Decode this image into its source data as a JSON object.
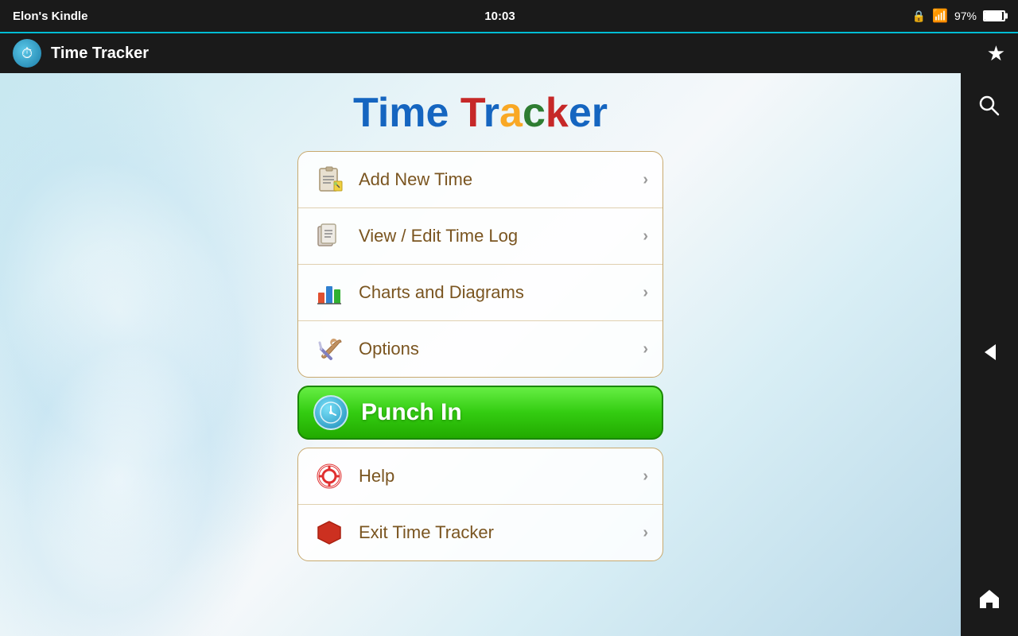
{
  "statusBar": {
    "deviceName": "Elon's Kindle",
    "time": "10:03",
    "batteryPercent": "97%"
  },
  "titleBar": {
    "appTitle": "Time Tracker"
  },
  "heading": {
    "text": "Time Tracker",
    "part1": "Time ",
    "part2": "Tracker"
  },
  "menu": {
    "card1": [
      {
        "id": "add-new-time",
        "label": "Add New Time",
        "icon": "notepad"
      },
      {
        "id": "view-edit-time-log",
        "label": "View / Edit Time Log",
        "icon": "list"
      },
      {
        "id": "charts-diagrams",
        "label": "Charts and Diagrams",
        "icon": "chart"
      },
      {
        "id": "options",
        "label": "Options",
        "icon": "wrench"
      }
    ],
    "punchIn": {
      "label": "Punch In",
      "icon": "clock"
    },
    "card2": [
      {
        "id": "help",
        "label": "Help",
        "icon": "lifebuoy"
      },
      {
        "id": "exit",
        "label": "Exit Time Tracker",
        "icon": "stop"
      }
    ]
  },
  "sidebar": {
    "searchLabel": "Search",
    "backLabel": "Back",
    "homeLabel": "Home"
  }
}
